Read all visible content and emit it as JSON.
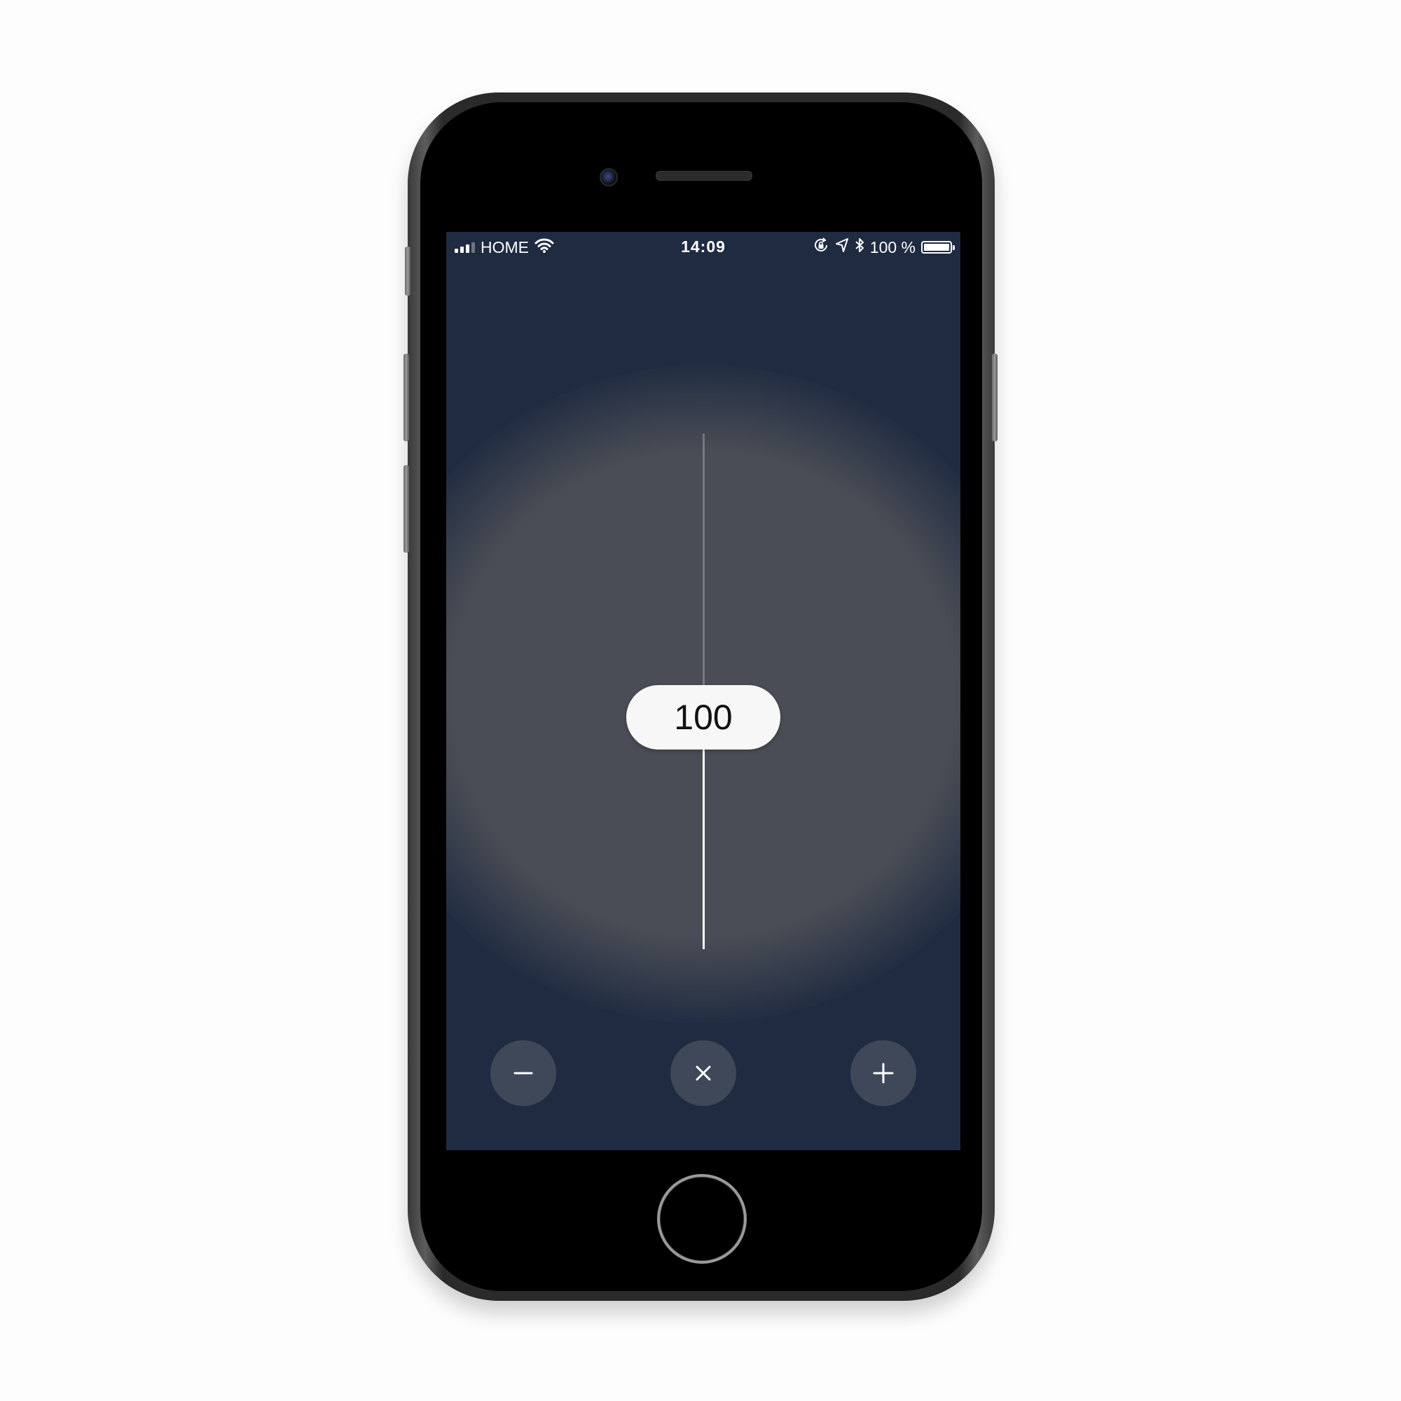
{
  "status_bar": {
    "carrier": "HOME",
    "time": "14:09",
    "battery_percent": "100 %",
    "signal_bars_active": 3,
    "signal_bars_total": 4,
    "icons": [
      "signal-icon",
      "wifi-icon",
      "rotation-lock-icon",
      "location-icon",
      "bluetooth-icon",
      "battery-icon"
    ]
  },
  "slider": {
    "value": "100",
    "level_fraction": 0.45
  },
  "controls": {
    "decrease_icon": "minus-icon",
    "close_icon": "close-icon",
    "increase_icon": "plus-icon"
  },
  "colors": {
    "screen_background": "#1f2b41",
    "glow": "#4a4d55",
    "button_background": "#3e4859",
    "thumb_background": "#f7f7f7"
  }
}
